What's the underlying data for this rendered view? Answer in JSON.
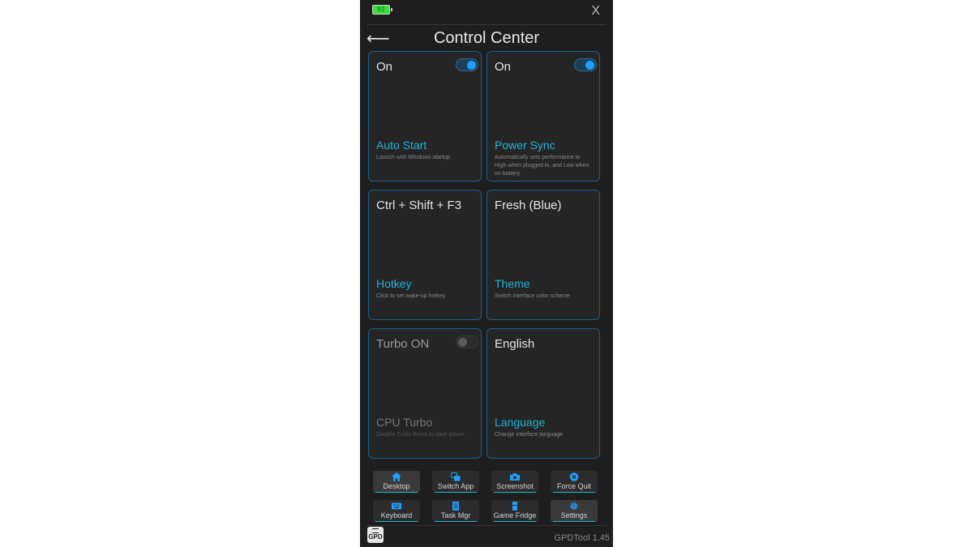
{
  "header": {
    "battery_level": "92",
    "close_label": "X",
    "back_label": "⟵",
    "title": "Control Center"
  },
  "cards": [
    {
      "value": "On",
      "name": "Auto Start",
      "desc": "Launch with Windows startup",
      "toggle": "on"
    },
    {
      "value": "On",
      "name": "Power Sync",
      "desc": "Automatically sets performance to High when plugged in, and Low when on battery",
      "toggle": "on"
    },
    {
      "value": "Ctrl + Shift + F3",
      "name": "Hotkey",
      "desc": "Click to set wake-up hotkey"
    },
    {
      "value": "Fresh (Blue)",
      "name": "Theme",
      "desc": "Switch interface color scheme"
    },
    {
      "value": "Turbo ON",
      "name": "CPU Turbo",
      "desc": "Disable Turbo Boost to save power",
      "toggle": "off"
    },
    {
      "value": "English",
      "name": "Language",
      "desc": "Change interface language"
    }
  ],
  "quick_actions": [
    {
      "label": "Desktop",
      "icon": "home-icon"
    },
    {
      "label": "Switch App",
      "icon": "switch-app-icon"
    },
    {
      "label": "Screenshot",
      "icon": "camera-icon"
    },
    {
      "label": "Force Quit",
      "icon": "close-circle-icon"
    },
    {
      "label": "Keyboard",
      "icon": "keyboard-icon"
    },
    {
      "label": "Task Mgr",
      "icon": "task-manager-icon"
    },
    {
      "label": "Game Fridge",
      "icon": "fridge-icon"
    },
    {
      "label": "Settings",
      "icon": "gear-icon"
    }
  ],
  "footer": {
    "logo_text": "GPD",
    "version": "GPDTool 1.45"
  },
  "colors": {
    "accent": "#1fb4d8",
    "panel_bg": "#1e1e1e",
    "card_border": "#1b5f8c",
    "toggle_on": "#1ea0ff",
    "battery": "#38e03a"
  }
}
